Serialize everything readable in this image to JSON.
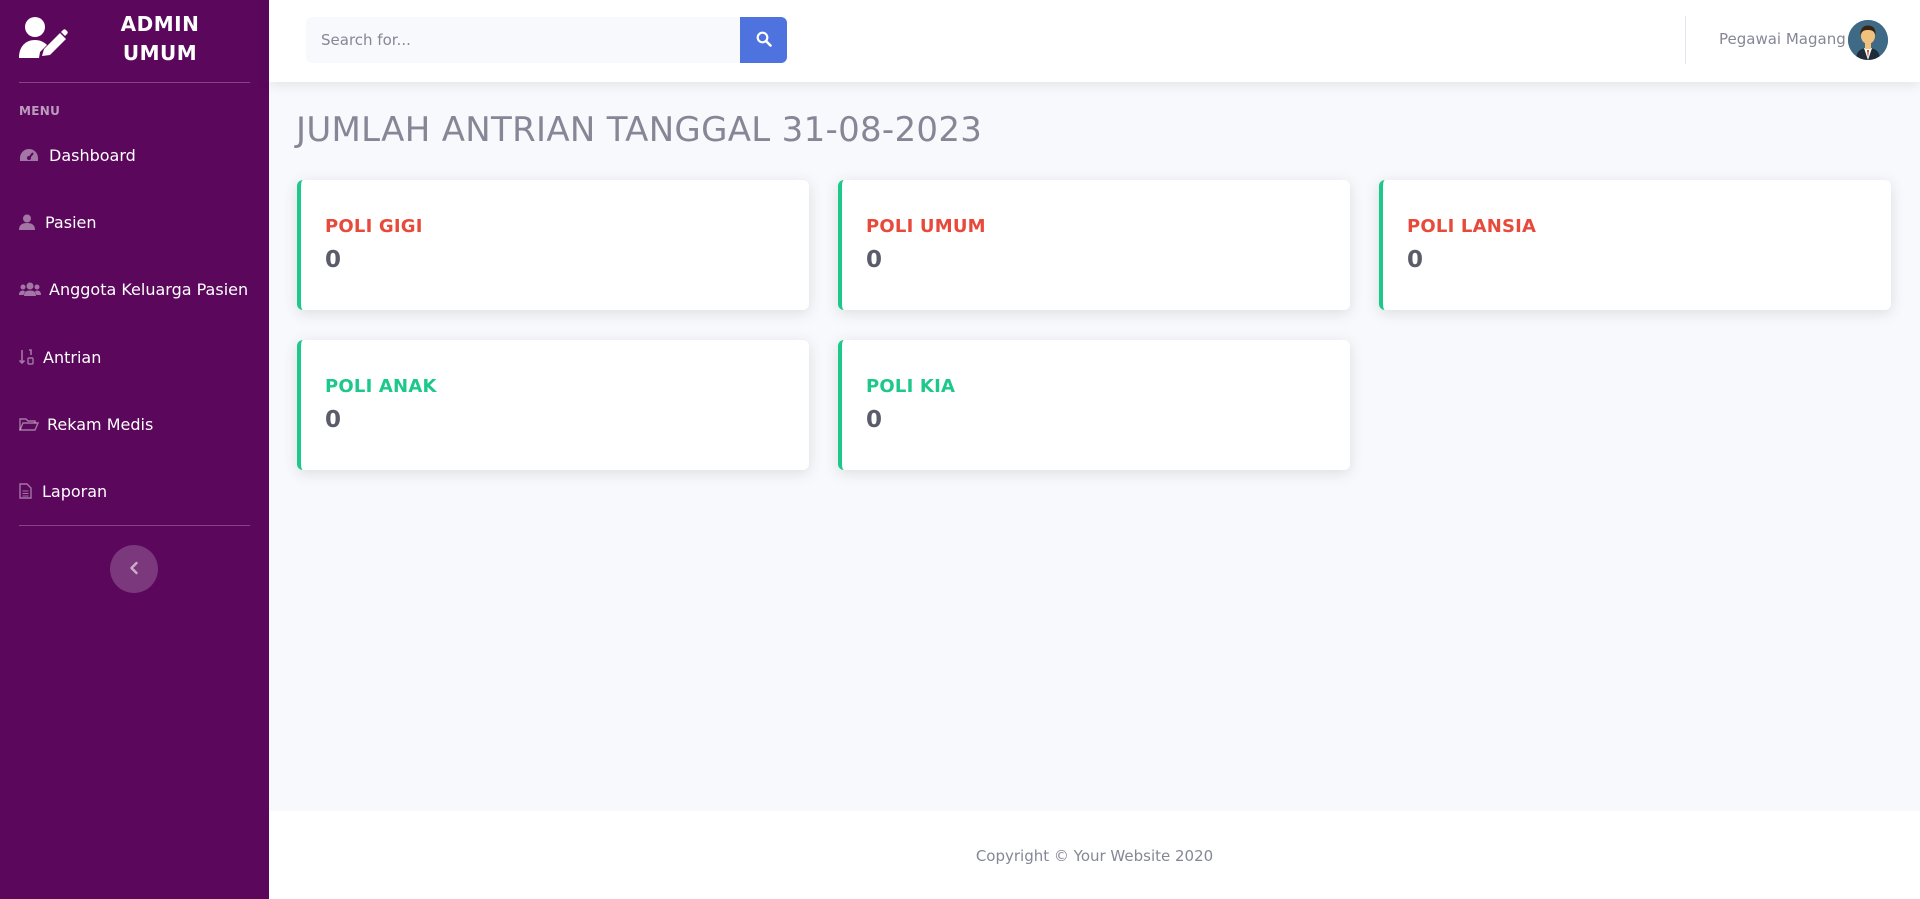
{
  "sidebar": {
    "brand": {
      "line1": "ADMIN",
      "line2": "UMUM",
      "icon": "user-edit-icon"
    },
    "menu_heading": "MENU",
    "items": [
      {
        "label": "Dashboard",
        "icon": "tachometer-icon"
      },
      {
        "label": "Pasien",
        "icon": "user-icon"
      },
      {
        "label": "Anggota Keluarga Pasien",
        "icon": "users-icon"
      },
      {
        "label": "Antrian",
        "icon": "sort-numeric-icon"
      },
      {
        "label": "Rekam Medis",
        "icon": "folder-open-icon"
      },
      {
        "label": "Laporan",
        "icon": "file-alt-icon"
      }
    ],
    "toggle_icon": "chevron-left-icon"
  },
  "topbar": {
    "search": {
      "placeholder": "Search for...",
      "value": "",
      "button_icon": "search-icon"
    },
    "user_name": "Pegawai Magang",
    "avatar": "avatar"
  },
  "main": {
    "title": "JUMLAH ANTRIAN TANGGAL 31-08-2023",
    "cards": [
      {
        "label": "POLI GIGI",
        "value": "0",
        "label_color": "#e74a3b"
      },
      {
        "label": "POLI UMUM",
        "value": "0",
        "label_color": "#e74a3b"
      },
      {
        "label": "POLI LANSIA",
        "value": "0",
        "label_color": "#e74a3b"
      },
      {
        "label": "POLI ANAK",
        "value": "0",
        "label_color": "#1cc88a"
      },
      {
        "label": "POLI KIA",
        "value": "0",
        "label_color": "#1cc88a"
      }
    ]
  },
  "footer": {
    "text": "Copyright © Your Website 2020"
  },
  "colors": {
    "sidebar_bg": "#5a075c",
    "primary": "#4e73df",
    "success": "#1cc88a",
    "danger": "#e74a3b"
  }
}
